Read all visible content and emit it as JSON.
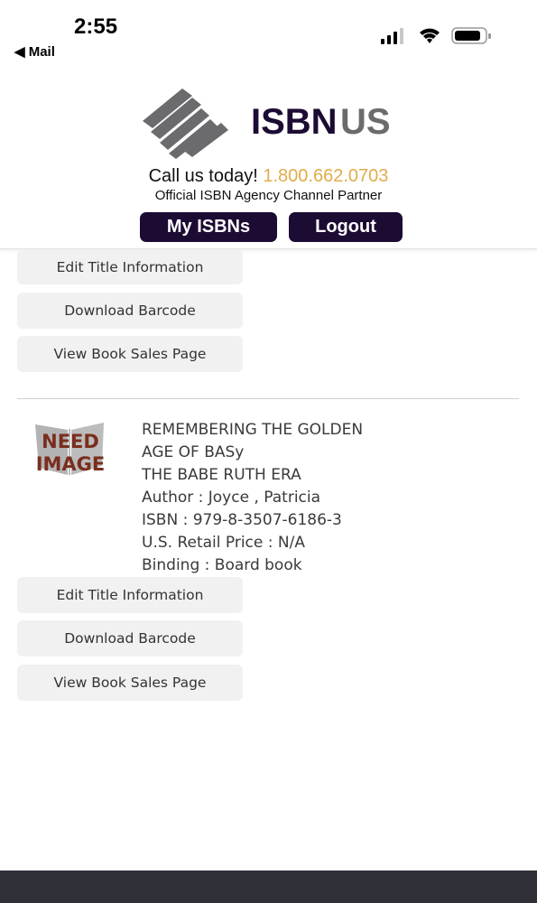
{
  "status_bar": {
    "time": "2:55",
    "back_label": "◀ Mail",
    "icons": [
      "signal-icon",
      "wifi-icon",
      "battery-icon"
    ]
  },
  "header": {
    "logo_text_isbn": "ISBN",
    "logo_text_us": "US",
    "call_prefix": "Call us today! ",
    "phone": "1.800.662.0703",
    "partner": "Official ISBN Agency Channel Partner",
    "my_isbns_label": "My ISBNs",
    "logout_label": "Logout",
    "colors": {
      "dark": "#1c0b33",
      "gray": "#6b6b6e",
      "phone": "#e0ad4a"
    }
  },
  "first_item": {
    "edit_label": "Edit Title Information",
    "download_label": "Download Barcode",
    "sales_label": "View Book Sales Page"
  },
  "second_item": {
    "image_placeholder": [
      "NEED",
      "IMAGE"
    ],
    "title_line1": "REMEMBERING THE GOLDEN",
    "title_line2": "AGE OF BASy",
    "title_line3": "THE BABE RUTH ERA",
    "author": "Author : Joyce , Patricia",
    "isbn": "ISBN : 979-8-3507-6186-3",
    "price": "U.S. Retail Price : N/A",
    "binding": "Binding : Board book",
    "edit_label": "Edit Title Information",
    "download_label": "Download Barcode",
    "sales_label": "View Book Sales Page"
  }
}
